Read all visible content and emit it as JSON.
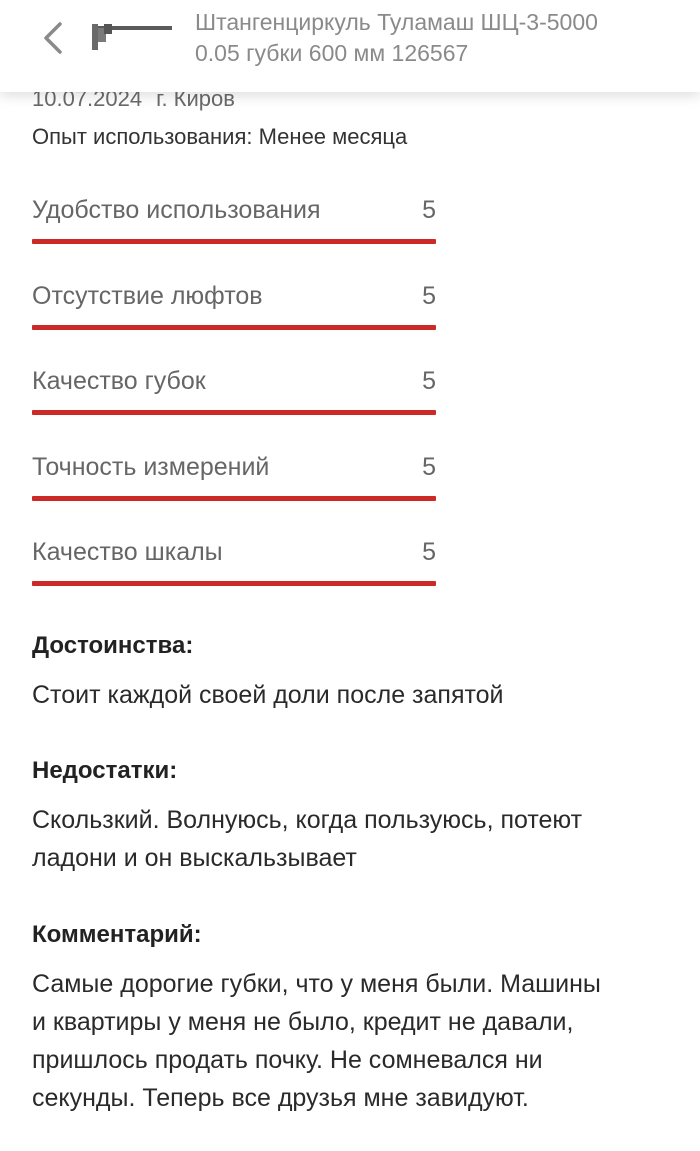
{
  "header": {
    "back_icon": "chevron-left-icon",
    "product_thumb": "caliper-thumbnail",
    "title_line1": "Штангенциркуль Туламаш ШЦ-3-5000",
    "title_line2": "0.05 губки 600 мм 126567"
  },
  "review": {
    "date": "10.07.2024",
    "city": "г. Киров",
    "experience": "Опыт использования: Менее месяца",
    "ratings": [
      {
        "label": "Удобство использования",
        "value": "5"
      },
      {
        "label": "Отсутствие люфтов",
        "value": "5"
      },
      {
        "label": "Качество губок",
        "value": "5"
      },
      {
        "label": "Точность измерений",
        "value": "5"
      },
      {
        "label": "Качество шкалы",
        "value": "5"
      }
    ],
    "rating_max": 5,
    "accent_color": "#cc2a26",
    "pros_heading": "Достоинства:",
    "pros_text": "Стоит каждой своей доли после запятой",
    "cons_heading": "Недостатки:",
    "cons_text_line1": "Скользкий. Волнуюсь, когда пользуюсь, потеют",
    "cons_text_line2": "ладони и он выскальзывает",
    "comment_heading": "Комментарий:",
    "comment_line1": "Самые дорогие губки, что у меня были. Машины",
    "comment_line2": "и квартиры у меня не было, кредит не давали,",
    "comment_line3": "пришлось продать почку. Не сомневался ни",
    "comment_line4": "секунды. Теперь все друзья мне завидуют."
  }
}
